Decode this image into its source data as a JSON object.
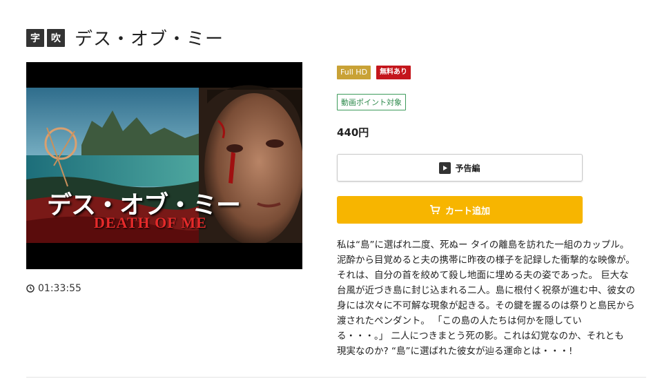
{
  "header": {
    "badges": [
      "字",
      "吹"
    ],
    "title": "デス・オブ・ミー"
  },
  "thumbnail": {
    "title_jp": "デス・オブ・ミー",
    "title_en": "DEATH OF ME"
  },
  "duration": "01:33:55",
  "tags": {
    "quality": "Full HD",
    "free": "無料あり",
    "points": "動画ポイント対象"
  },
  "price": "440円",
  "buttons": {
    "trailer": "予告編",
    "cart": "カート追加"
  },
  "description": "私は“島”に選ばれ二度、死ぬー タイの離島を訪れた一組のカップル。\n泥酔から目覚めると夫の携帯に昨夜の様子を記録した衝撃的な映像が。\nそれは、自分の首を絞めて殺し地面に埋める夫の姿であった。 巨大な\n台風が近づき島に封じ込まれる二人。島に根付く祝祭が進む中、彼女の\n身には次々に不可解な現象が起きる。その鍵を握るのは祭りと島民から\n渡されたペンダント。 「この島の人たちは何かを隠してい\nる・・・。」 二人につきまとう死の影。これは幻覚なのか、それとも\n現実なのか? “島”に選ばれた彼女が辿る運命とは・・・!",
  "colors": {
    "accent_cart": "#f7b500",
    "hd_gold": "#c9a236",
    "free_red": "#c4161c",
    "points_green": "#2e8a4c"
  }
}
